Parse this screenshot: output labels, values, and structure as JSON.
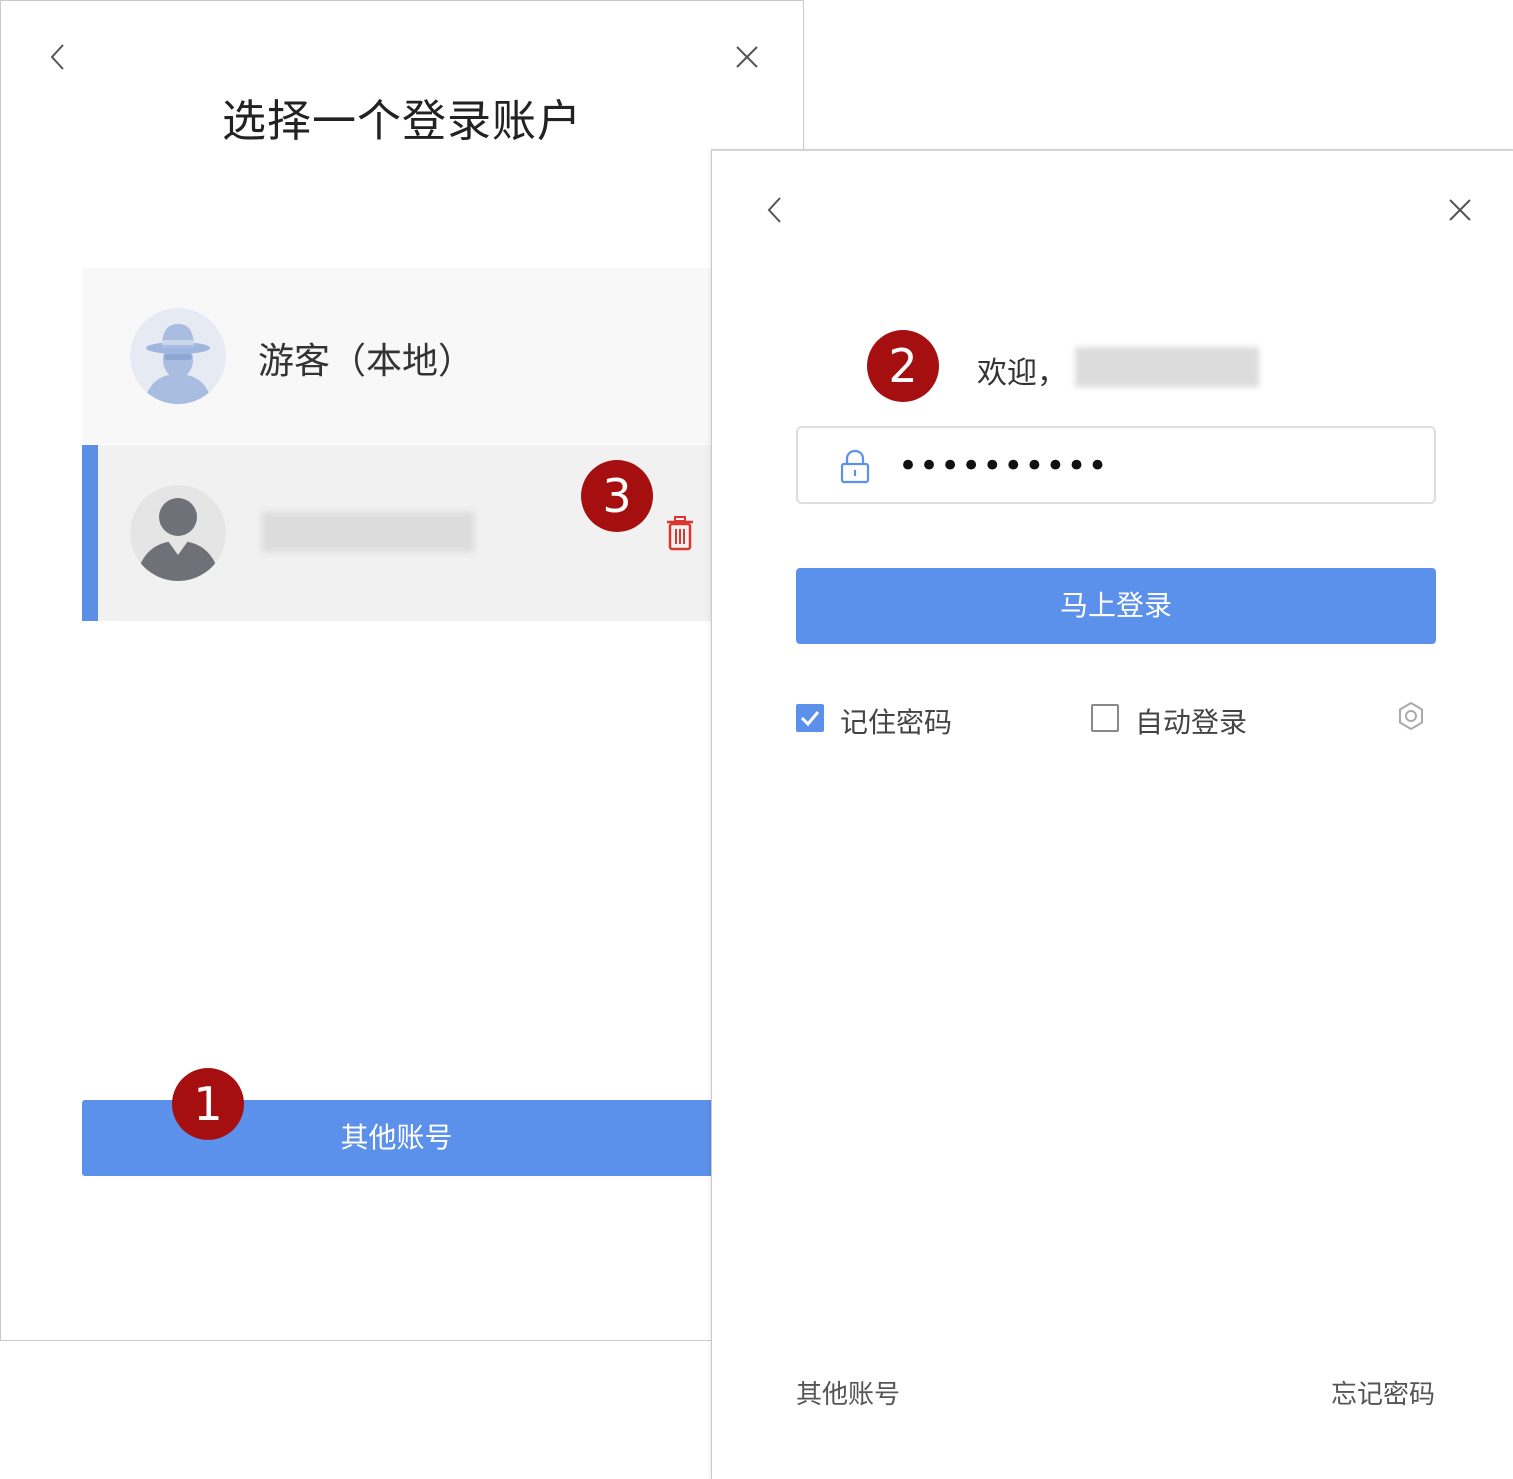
{
  "left_panel": {
    "title": "选择一个登录账户",
    "accounts": [
      {
        "label": "游客（本地）",
        "type": "guest"
      },
      {
        "label": "",
        "type": "user",
        "obscured": true
      }
    ],
    "other_account_button": "其他账号",
    "badges": [
      "1",
      "3"
    ]
  },
  "right_panel": {
    "welcome": "欢迎，",
    "password_value": "••••••••••",
    "login_button": "马上登录",
    "remember_password": {
      "label": "记住密码",
      "checked": true
    },
    "auto_login": {
      "label": "自动登录",
      "checked": false
    },
    "footer_other_account": "其他账号",
    "footer_forgot_password": "忘记密码",
    "badge": "2"
  },
  "colors": {
    "accent": "#5b90eb",
    "badge": "#a60f0f",
    "delete": "#d9372f",
    "active_bar": "#5b8fe6"
  },
  "icons": [
    "back-arrow-icon",
    "close-icon",
    "guest-avatar-icon",
    "user-avatar-icon",
    "trash-icon",
    "lock-icon",
    "gear-icon",
    "checkmark-icon"
  ]
}
